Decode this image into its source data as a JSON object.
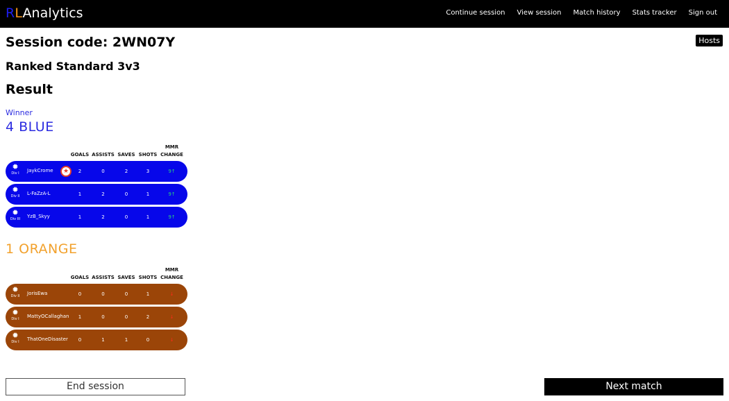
{
  "nav": {
    "brand_r": "R",
    "brand_l": "L",
    "brand_rest": "Analytics",
    "links": [
      "Continue session",
      "View session",
      "Match history",
      "Stats tracker",
      "Sign out"
    ]
  },
  "hosts_label": "Hosts",
  "session": {
    "code": "Session code: 2WN07Y",
    "mode": "Ranked Standard 3v3",
    "result_heading": "Result",
    "winner_label": "Winner"
  },
  "columns": [
    "GOALS",
    "ASSISTS",
    "SAVES",
    "SHOTS",
    "MMR CHANGE"
  ],
  "teams": [
    {
      "title": "4 BLUE",
      "color": "#0707ea",
      "players": [
        {
          "name": "JaykCrome",
          "rank_div": "Div I",
          "mvp": true,
          "goals": "2",
          "assists": "0",
          "saves": "2",
          "shots": "3",
          "mmr": "9↑"
        },
        {
          "name": "L-FaZzA-L",
          "rank_div": "Div II",
          "mvp": false,
          "goals": "1",
          "assists": "2",
          "saves": "0",
          "shots": "1",
          "mmr": "9↑"
        },
        {
          "name": "YzB_Skyy",
          "rank_div": "Div III",
          "mvp": false,
          "goals": "1",
          "assists": "2",
          "saves": "0",
          "shots": "1",
          "mmr": "9↑"
        }
      ]
    },
    {
      "title": "1 ORANGE",
      "color": "#9b4508",
      "players": [
        {
          "name": "JorisEwa",
          "rank_div": "Div II",
          "mvp": false,
          "goals": "0",
          "assists": "0",
          "saves": "0",
          "shots": "1",
          "mmr": "↓"
        },
        {
          "name": "MattyOCallaghan",
          "rank_div": "Div I",
          "mvp": false,
          "goals": "1",
          "assists": "0",
          "saves": "0",
          "shots": "2",
          "mmr": "↓"
        },
        {
          "name": "ThatOneDisaster",
          "rank_div": "Div I",
          "mvp": false,
          "goals": "0",
          "assists": "1",
          "saves": "1",
          "shots": "0",
          "mmr": "↓"
        }
      ]
    }
  ],
  "buttons": {
    "end_session": "End session",
    "next_match": "Next match"
  },
  "icons": {
    "rank": "rank-gem-icon",
    "mvp": "mvp-star-icon"
  }
}
